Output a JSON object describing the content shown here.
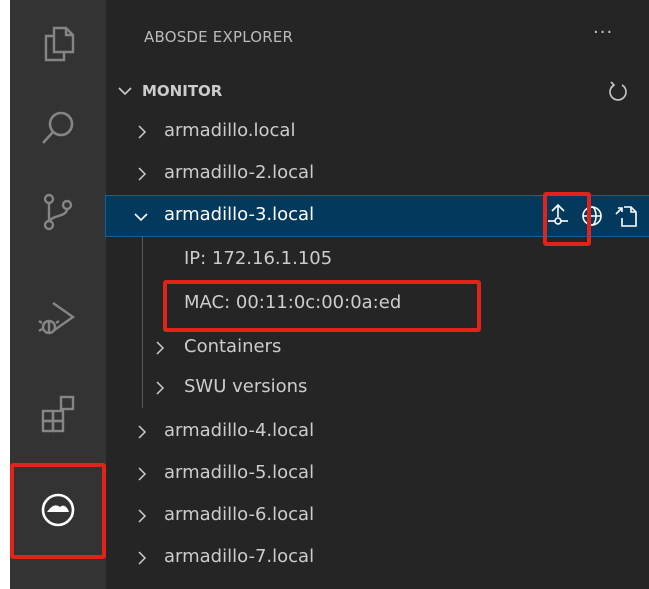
{
  "sidebar": {
    "title": "ABOSDE EXPLORER",
    "more_label": "···"
  },
  "monitor": {
    "title": "MONITOR",
    "devices": [
      {
        "label": "armadillo.local",
        "expanded": false
      },
      {
        "label": "armadillo-2.local",
        "expanded": false
      },
      {
        "label": "armadillo-3.local",
        "expanded": true,
        "selected": true
      },
      {
        "label": "armadillo-4.local",
        "expanded": false
      },
      {
        "label": "armadillo-5.local",
        "expanded": false
      },
      {
        "label": "armadillo-6.local",
        "expanded": false
      },
      {
        "label": "armadillo-7.local",
        "expanded": false
      }
    ],
    "details": {
      "ip": "IP: 172.16.1.105",
      "mac": "MAC: 00:11:0c:00:0a:ed",
      "containers": "Containers",
      "swu_versions": "SWU versions"
    }
  },
  "row_actions": [
    "upload-icon",
    "globe-icon",
    "open-external-icon"
  ],
  "activity_bar": [
    "explorer-icon",
    "search-icon",
    "source-control-icon",
    "run-debug-icon",
    "extensions-icon",
    "abosde-icon"
  ],
  "colors": {
    "highlight": "#e0241a",
    "selection": "#04395e",
    "activity_bar": "#333333",
    "sidebar": "#252526"
  }
}
